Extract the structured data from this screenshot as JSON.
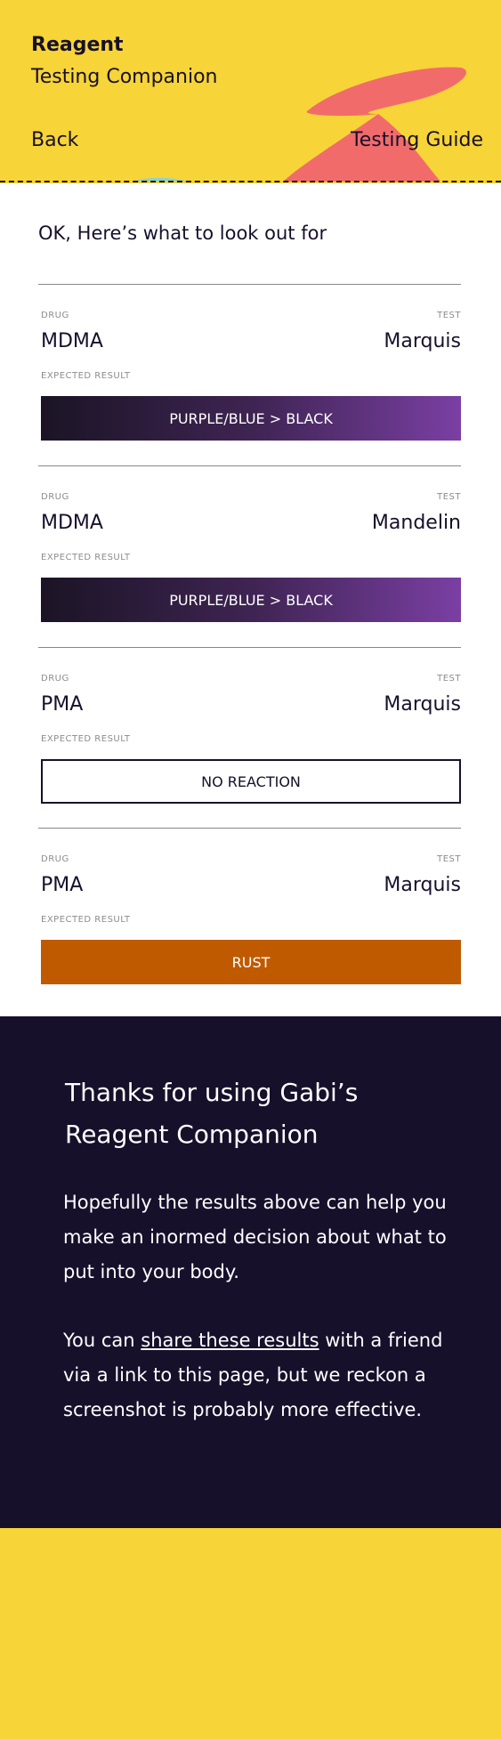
{
  "header": {
    "title": "Reagent",
    "subtitle": "Testing Companion",
    "back_label": "Back",
    "guide_label": "Testing Guide",
    "shape_color": "#f26b6b"
  },
  "main": {
    "intro": "OK, Here’s what to look out for",
    "labels": {
      "drug": "DRUG",
      "test": "TEST",
      "expected": "EXPECTED RESULT"
    },
    "results": [
      {
        "drug": "MDMA",
        "test": "Marquis",
        "result": "PURPLE/BLUE > BLACK",
        "style": "gradient"
      },
      {
        "drug": "MDMA",
        "test": "Mandelin",
        "result": "PURPLE/BLUE > BLACK",
        "style": "gradient"
      },
      {
        "drug": "PMA",
        "test": "Marquis",
        "result": "NO REACTION",
        "style": "none"
      },
      {
        "drug": "PMA",
        "test": "Marquis",
        "result": "RUST",
        "style": "rust",
        "color": "#c05a00"
      }
    ]
  },
  "footer": {
    "title": "Thanks for using Gabi’s Reagent Companion",
    "paragraph1": "Hopefully the results above can help you make an inormed decision about what to put into your body.",
    "paragraph2_before": "You can ",
    "paragraph2_link": "share these results",
    "paragraph2_after": " with a friend via a link to this page, but we reckon a screenshot is probably more effective."
  }
}
